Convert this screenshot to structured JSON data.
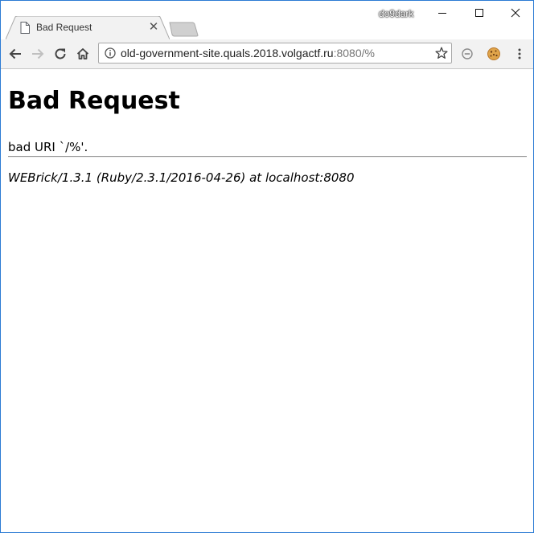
{
  "window": {
    "profile_name": "do9dark",
    "controls": {
      "minimize": "minimize",
      "maximize": "maximize",
      "close": "close"
    }
  },
  "tab": {
    "title": "Bad Request",
    "favicon": "page-icon",
    "close_icon": "close-icon"
  },
  "toolbar": {
    "back": "arrow-left-icon",
    "forward": "arrow-right-icon",
    "reload": "reload-icon",
    "home": "home-icon",
    "url_host": "old-government-site.quals.2018.volgactf.ru",
    "url_rest": ":8080/%",
    "info_icon": "info-icon",
    "bookmark_icon": "star-icon",
    "extensions": [
      "block-icon",
      "cookie-icon"
    ],
    "menu_icon": "kebab-menu-icon"
  },
  "page": {
    "heading": "Bad Request",
    "message": "bad URI `/%'.",
    "server": "WEBrick/1.3.1 (Ruby/2.3.1/2016-04-26) at localhost:8080"
  },
  "colors": {
    "window_border": "#2b7bd4",
    "toolbar_bg": "#f2f2f2",
    "tab_bg": "#f2f2f2"
  }
}
